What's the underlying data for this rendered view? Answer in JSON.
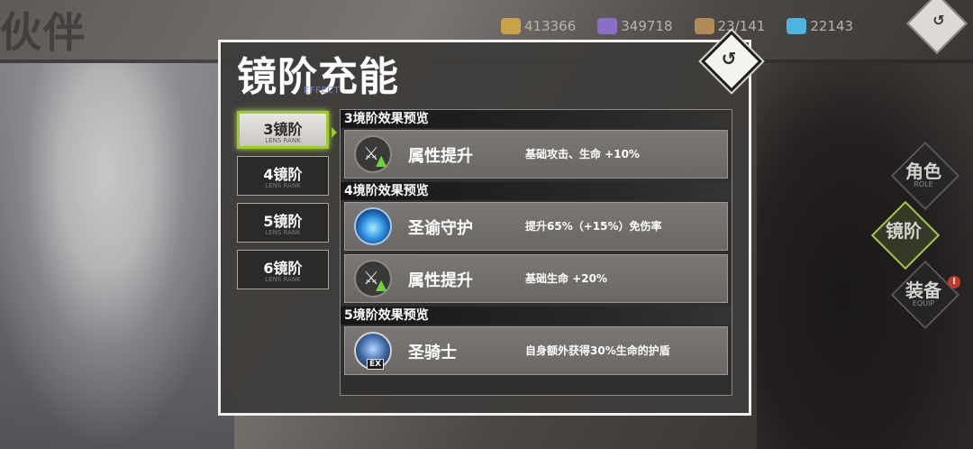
{
  "background": {
    "screen_title": "伙伴",
    "resources": [
      {
        "name": "gold",
        "icon": "gold-coin-icon",
        "value": "413366",
        "color": "#c9a24a"
      },
      {
        "name": "crystal",
        "icon": "purple-crystal-icon",
        "value": "349718",
        "color": "#8a6fc4"
      },
      {
        "name": "crate",
        "icon": "crate-icon",
        "value": "23/141",
        "color": "#b08a58"
      },
      {
        "name": "diamond",
        "icon": "blue-diamond-icon",
        "value": "22143",
        "color": "#4fb4e0"
      }
    ],
    "side_nav": [
      {
        "label": "角色",
        "sub": "ROLE"
      },
      {
        "label": "镜阶",
        "sub": ""
      },
      {
        "label": "装备",
        "sub": "EQUIP",
        "badge": "!"
      }
    ],
    "back_glyph": "↺"
  },
  "modal": {
    "title": "镜阶充能",
    "subtitle": "EFFECT",
    "close_glyph": "↺",
    "rank_tabs": [
      {
        "label": "3镜阶",
        "sub": "LENS RANK"
      },
      {
        "label": "4镜阶",
        "sub": "LENS RANK"
      },
      {
        "label": "5镜阶",
        "sub": "LENS RANK"
      },
      {
        "label": "6镜阶",
        "sub": "LENS RANK"
      }
    ],
    "groups": [
      {
        "header": "3境阶效果预览",
        "effects": [
          {
            "icon": "attribute-boost-icon",
            "name": "属性提升",
            "desc": "基础攻击、生命 +10%"
          }
        ]
      },
      {
        "header": "4境阶效果预览",
        "effects": [
          {
            "icon": "holy-shield-icon",
            "name": "圣谕守护",
            "desc": "提升65%（+15%）免伤率"
          },
          {
            "icon": "attribute-boost-icon",
            "name": "属性提升",
            "desc": "基础生命 +20%"
          }
        ]
      },
      {
        "header": "5境阶效果预览",
        "effects": [
          {
            "icon": "paladin-ex-icon",
            "name": "圣骑士",
            "desc": "自身额外获得30%生命的护盾",
            "badge": "EX"
          }
        ]
      }
    ]
  },
  "colors": {
    "accent_green": "#9bcc2a",
    "panel_border": "#f1f0ee",
    "subtitle_blue": "#6e7fd6"
  }
}
